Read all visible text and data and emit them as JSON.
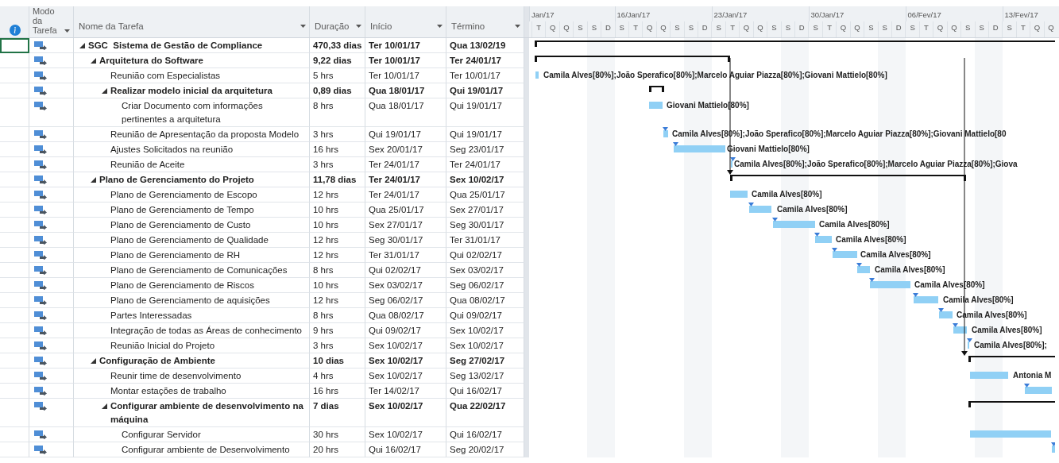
{
  "headers": [
    {
      "label": "Modo da Tarefa"
    },
    {
      "label": "Nome da Tarefa"
    },
    {
      "label": "Duração"
    },
    {
      "label": "Início"
    },
    {
      "label": "Término"
    }
  ],
  "timescale": {
    "weeks": [
      "Jan/17",
      "16/Jan/17",
      "23/Jan/17",
      "30/Jan/17",
      "06/Fev/17",
      "13/Fev/17"
    ],
    "days": [
      "T",
      "Q",
      "Q",
      "S",
      "S",
      "D",
      "S",
      "T",
      "Q",
      "Q",
      "S",
      "S",
      "D",
      "S",
      "T",
      "Q",
      "Q",
      "S",
      "S",
      "D",
      "S",
      "T",
      "Q",
      "Q",
      "S",
      "S",
      "D",
      "S",
      "T",
      "Q",
      "Q",
      "S",
      "S",
      "D",
      "S",
      "T",
      "Q",
      "Q"
    ]
  },
  "tasks": [
    {
      "name": "SGC  Sistema de Gestão de Compliance",
      "duration": "470,33 dias",
      "start": "Ter 10/01/17",
      "finish": "Qua 13/02/19",
      "selected": true,
      "expanded": true,
      "children": [
        {
          "name": "Arquitetura do Software",
          "duration": "9,22 dias",
          "start": "Ter 10/01/17",
          "finish": "Ter 24/01/17",
          "selected": false,
          "expanded": true,
          "children": [
            {
              "name": "Reunião com Especialistas",
              "duration": "5 hrs",
              "start": "Ter 10/01/17",
              "finish": "Ter 10/01/17",
              "selected": false,
              "resources": "Camila Alves[80%];João Sperafico[80%];Marcelo Aguiar Piazza[80%];Giovani Mattielo[80%]"
            },
            {
              "name": "Realizar modelo inicial da arquitetura",
              "duration": "0,89 dias",
              "start": "Qua 18/01/17",
              "finish": "Qui 19/01/17",
              "selected": false,
              "expanded": true,
              "children": [
                {
                  "name": "Criar Documento com informações pertinentes a arquitetura",
                  "duration": "8 hrs",
                  "start": "Qua 18/01/17",
                  "finish": "Qui 19/01/17",
                  "selected": false,
                  "resources": "Giovani Mattielo[80%]"
                }
              ]
            },
            {
              "name": "Reunião de Apresentação da proposta Modelo",
              "duration": "3 hrs",
              "start": "Qui 19/01/17",
              "finish": "Qui 19/01/17",
              "selected": false,
              "resources": "Camila Alves[80%];João Sperafico[80%];Marcelo Aguiar Piazza[80%];Giovani Mattielo[80"
            },
            {
              "name": "Ajustes Solicitados na reunião",
              "duration": "16 hrs",
              "start": "Sex 20/01/17",
              "finish": "Seg 23/01/17",
              "selected": false,
              "resources": "Giovani Mattielo[80%]"
            },
            {
              "name": "Reunião de Aceite",
              "duration": "3 hrs",
              "start": "Ter 24/01/17",
              "finish": "Ter 24/01/17",
              "selected": false,
              "resources": "Camila Alves[80%];João Sperafico[80%];Marcelo Aguiar Piazza[80%];Giova"
            }
          ]
        },
        {
          "name": "Plano de Gerenciamento do Projeto",
          "duration": "11,78 dias",
          "start": "Ter 24/01/17",
          "finish": "Sex 10/02/17",
          "selected": false,
          "expanded": true,
          "children": [
            {
              "name": "Plano de Gerenciamento de Escopo",
              "duration": "12 hrs",
              "start": "Ter 24/01/17",
              "finish": "Qua 25/01/17",
              "selected": false,
              "resources": "Camila Alves[80%]"
            },
            {
              "name": "Plano de Gerenciamento de Tempo",
              "duration": "10 hrs",
              "start": "Qua 25/01/17",
              "finish": "Sex 27/01/17",
              "selected": false,
              "resources": "Camila Alves[80%]"
            },
            {
              "name": "Plano de Gerenciamento de Custo",
              "duration": "10 hrs",
              "start": "Sex 27/01/17",
              "finish": "Seg 30/01/17",
              "selected": false,
              "resources": "Camila Alves[80%]"
            },
            {
              "name": "Plano de Gerenciamento de Qualidade",
              "duration": "12 hrs",
              "start": "Seg 30/01/17",
              "finish": "Ter 31/01/17",
              "selected": false,
              "resources": "Camila Alves[80%]"
            },
            {
              "name": "Plano de Gerenciamento de RH",
              "duration": "12 hrs",
              "start": "Ter 31/01/17",
              "finish": "Qui 02/02/17",
              "selected": false,
              "resources": "Camila Alves[80%]"
            },
            {
              "name": "Plano de Gerenciamento de Comunicações",
              "duration": "8 hrs",
              "start": "Qui 02/02/17",
              "finish": "Sex 03/02/17",
              "selected": false,
              "resources": "Camila Alves[80%]"
            },
            {
              "name": "Plano de Gerenciamento de Riscos",
              "duration": "10 hrs",
              "start": "Sex 03/02/17",
              "finish": "Seg 06/02/17",
              "selected": false,
              "resources": "Camila Alves[80%]"
            },
            {
              "name": "Plano de Gerenciamento de aquisições",
              "duration": "12 hrs",
              "start": "Seg 06/02/17",
              "finish": "Qua 08/02/17",
              "selected": false,
              "resources": "Camila Alves[80%]"
            },
            {
              "name": "Partes Interessadas",
              "duration": "8 hrs",
              "start": "Qua 08/02/17",
              "finish": "Qui 09/02/17",
              "selected": false,
              "resources": "Camila Alves[80%]"
            },
            {
              "name": "Integração de todas as Áreas de conhecimento",
              "duration": "9 hrs",
              "start": "Qui 09/02/17",
              "finish": "Sex 10/02/17",
              "selected": false,
              "resources": "Camila Alves[80%]"
            },
            {
              "name": "Reunião Inicial do Projeto",
              "duration": "3 hrs",
              "start": "Sex 10/02/17",
              "finish": "Sex 10/02/17",
              "selected": false,
              "resources": "Camila Alves[80%];"
            }
          ]
        },
        {
          "name": "Configuração de Ambiente",
          "duration": "10 dias",
          "start": "Sex 10/02/17",
          "finish": "Seg 27/02/17",
          "selected": false,
          "expanded": true,
          "children": [
            {
              "name": "Reunir time de desenvolvimento",
              "duration": "4 hrs",
              "start": "Sex 10/02/17",
              "finish": "Seg 13/02/17",
              "selected": false,
              "resources": "Antonia M"
            },
            {
              "name": "Montar estações de trabalho",
              "duration": "16 hrs",
              "start": "Ter 14/02/17",
              "finish": "Qui 16/02/17",
              "selected": false
            },
            {
              "name": "Configurar ambiente de desenvolvimento na máquina",
              "duration": "7 dias",
              "start": "Sex 10/02/17",
              "finish": "Qua 22/02/17",
              "selected": false,
              "expanded": true,
              "children": [
                {
                  "name": "Configurar Servidor",
                  "duration": "30 hrs",
                  "start": "Sex 10/02/17",
                  "finish": "Qui 16/02/17",
                  "selected": false
                },
                {
                  "name": "Configurar ambiente de Desenvolvimento",
                  "duration": "20 hrs",
                  "start": "Qui 16/02/17",
                  "finish": "Seg 20/02/17",
                  "selected": false
                }
              ]
            }
          ]
        }
      ]
    }
  ]
}
